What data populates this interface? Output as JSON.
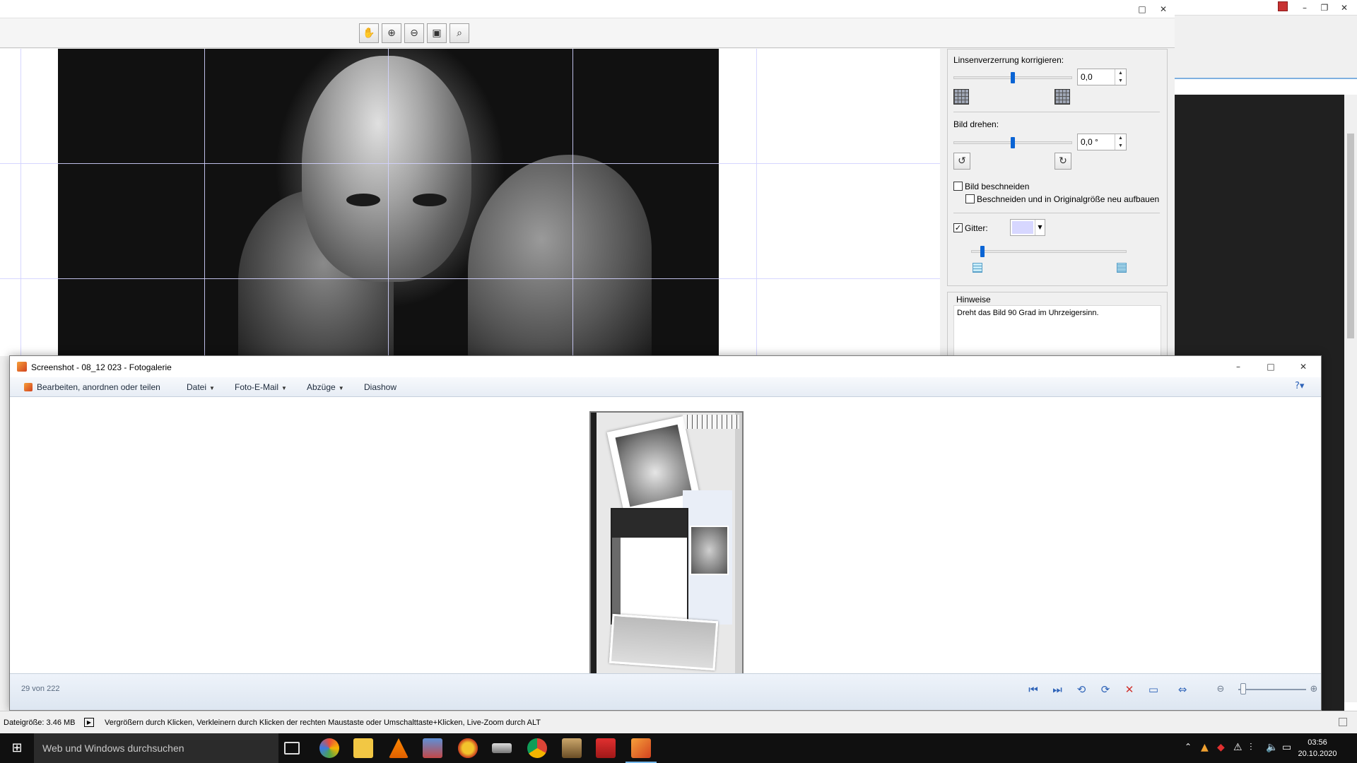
{
  "editor": {
    "toolbar": [
      "hand-icon",
      "zoom-in-icon",
      "zoom-out-icon",
      "fit-icon",
      "zoom-100-icon"
    ],
    "panel": {
      "lens_label": "Linsenverzerrung korrigieren:",
      "lens_value": "0,0",
      "rotate_label": "Bild drehen:",
      "rotate_value": "0,0 °",
      "crop_label": "Bild beschneiden",
      "crop_rebuild_label": "Beschneiden und in Originalgröße neu aufbauen",
      "grid_label": "Gitter:",
      "grid_checked": true,
      "grid_color": "#d7d7ff",
      "hints_title": "Hinweise",
      "hints_text": "Dreht das Bild 90 Grad im Uhrzeigersinn."
    },
    "status": {
      "filesize": "Dateigröße: 3.46 MB",
      "hint": "Vergrößern durch Klicken, Verkleinern durch Klicken der rechten Maustaste oder Umschalttaste+Klicken, Live-Zoom durch ALT"
    }
  },
  "gallery": {
    "title": "Screenshot - 08_12 023 - Fotogalerie",
    "menu": {
      "edit": "Bearbeiten, anordnen oder teilen",
      "file": "Datei",
      "email": "Foto-E-Mail",
      "prints": "Abzüge",
      "slideshow": "Diashow"
    },
    "counter": "29 von 222"
  },
  "taskbar": {
    "search_placeholder": "Web und Windows durchsuchen",
    "time": "03:56",
    "date": "20.10.2020"
  }
}
